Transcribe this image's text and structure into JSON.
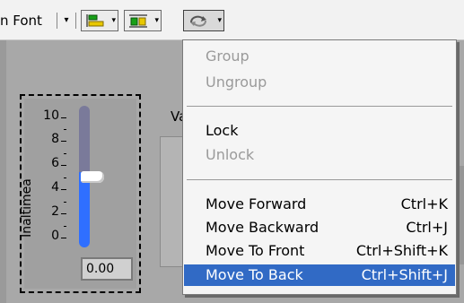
{
  "toolbar": {
    "font_ring_label": "n Font",
    "font_ring_arrow": "▾",
    "align_button_icon": "align-objects-icon",
    "distribute_button_icon": "distribute-objects-icon",
    "reorder_button_icon": "reorder-objects-icon",
    "dropdown_glyph": "▾"
  },
  "front_panel": {
    "slider": {
      "label": "Inaltimea",
      "scale": [
        "10",
        "8",
        "6",
        "4",
        "2",
        "0"
      ],
      "scale_min": 0,
      "scale_max": 10,
      "value": 5,
      "digital_display": "0.00",
      "fill_color": "#2f6fff",
      "track_color": "#7a7a9a"
    },
    "partial_label": "Va"
  },
  "menu": {
    "items": [
      {
        "label": "Group",
        "shortcut": "",
        "enabled": false
      },
      {
        "label": "Ungroup",
        "shortcut": "",
        "enabled": false
      },
      {
        "label": "Lock",
        "shortcut": "",
        "enabled": true
      },
      {
        "label": "Unlock",
        "shortcut": "",
        "enabled": false
      },
      {
        "label": "Move Forward",
        "shortcut": "Ctrl+K",
        "enabled": true
      },
      {
        "label": "Move Backward",
        "shortcut": "Ctrl+J",
        "enabled": true
      },
      {
        "label": "Move To Front",
        "shortcut": "Ctrl+Shift+K",
        "enabled": true
      },
      {
        "label": "Move To Back",
        "shortcut": "Ctrl+Shift+J",
        "enabled": true,
        "selected": true
      }
    ],
    "highlight_color": "#316ac5"
  }
}
